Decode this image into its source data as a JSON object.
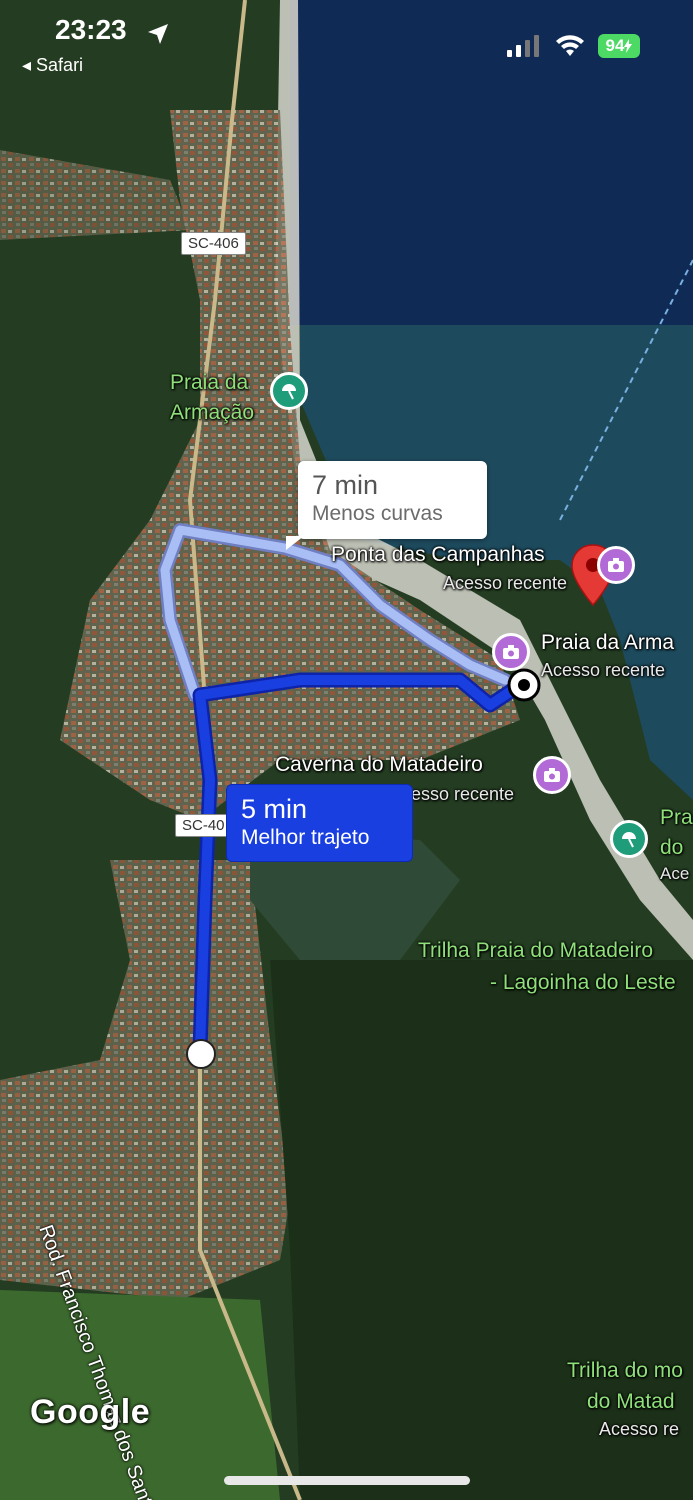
{
  "status_bar": {
    "time": "23:23",
    "back_label": "◂ Safari",
    "battery": "94"
  },
  "route_options": {
    "alternative": {
      "time": "7 min",
      "label": "Menos curvas"
    },
    "best": {
      "time": "5 min",
      "label": "Melhor trajeto"
    }
  },
  "roads": {
    "sc406_top": "SC-406",
    "sc406_mid": "SC-40",
    "rod": "Rod. Francisco Thomaz dos Santos"
  },
  "places": {
    "praia_armacao": {
      "line1": "Praia da",
      "line2": "Armação"
    },
    "ponta_campanhas": {
      "name": "Ponta das Campanhas",
      "sub": "Acesso recente"
    },
    "praia_arma": {
      "name": "Praia da Arma",
      "sub": "Acesso recente"
    },
    "caverna": {
      "name": "Caverna do Matadeiro",
      "sub": "esso recente"
    },
    "pra_right": {
      "line1": "Pra",
      "line2": "do",
      "line3": "Ace"
    },
    "trilha_matadeiro": {
      "line1": "Trilha Praia do Matadeiro",
      "line2": "- Lagoinha do Leste"
    },
    "trilha_bottom": {
      "line1": "Trilha do mo",
      "line2": "do Matad",
      "sub": "Acesso re"
    }
  },
  "logo": "Google",
  "colors": {
    "best_route": "#1a3fe0",
    "alt_route": "#a9bef5",
    "poi_green": "#8fe07a",
    "pin_red": "#e53935",
    "poi_purple": "#b26bd6"
  }
}
